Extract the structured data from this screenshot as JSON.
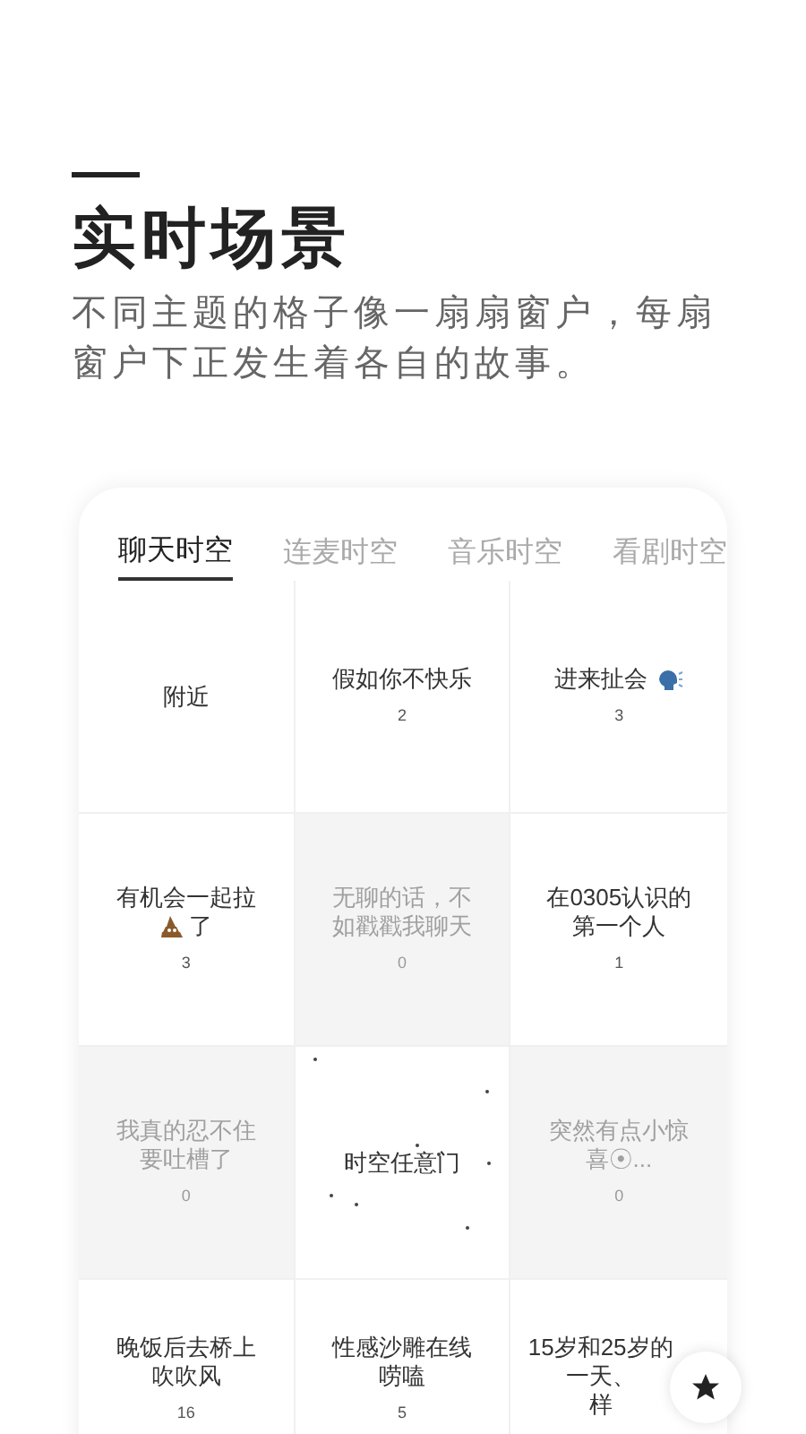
{
  "header": {
    "title": "实时场景",
    "subtitle": "不同主题的格子像一扇扇窗户，每扇窗户下正发生着各自的故事。"
  },
  "tabs": [
    {
      "label": "聊天时空",
      "selected": true
    },
    {
      "label": "连麦时空",
      "selected": false
    },
    {
      "label": "音乐时空",
      "selected": false
    },
    {
      "label": "看剧时空",
      "selected": false
    }
  ],
  "cells": [
    {
      "title": "附近",
      "dim": false,
      "kind": "plain"
    },
    {
      "title": "假如你不快乐",
      "count": "2",
      "dim": false,
      "kind": "plain"
    },
    {
      "title": "进来扯会",
      "count": "3",
      "dim": false,
      "kind": "speech"
    },
    {
      "title": "有机会一起拉",
      "title2": "了",
      "count": "3",
      "dim": false,
      "kind": "poop"
    },
    {
      "title": "无聊的话，不如戳戳我聊天",
      "count": "0",
      "dim": true,
      "kind": "plain"
    },
    {
      "title": "在0305认识的第一个人",
      "count": "1",
      "dim": false,
      "kind": "plain"
    },
    {
      "title": "我真的忍不住要吐槽了",
      "count": "0",
      "dim": true,
      "kind": "plain"
    },
    {
      "title": "时空任意门",
      "dim": false,
      "kind": "stars"
    },
    {
      "title": "突然有点小惊喜☉...",
      "count": "0",
      "dim": true,
      "kind": "plain"
    },
    {
      "title": "晚饭后去桥上吹吹风",
      "count": "16",
      "dim": false,
      "kind": "plain"
    },
    {
      "title": "性感沙雕在线唠嗑",
      "count": "5",
      "dim": false,
      "kind": "plain"
    },
    {
      "title": "15岁和25岁的一天、",
      "title2": "样",
      "dim": false,
      "kind": "corner"
    }
  ]
}
